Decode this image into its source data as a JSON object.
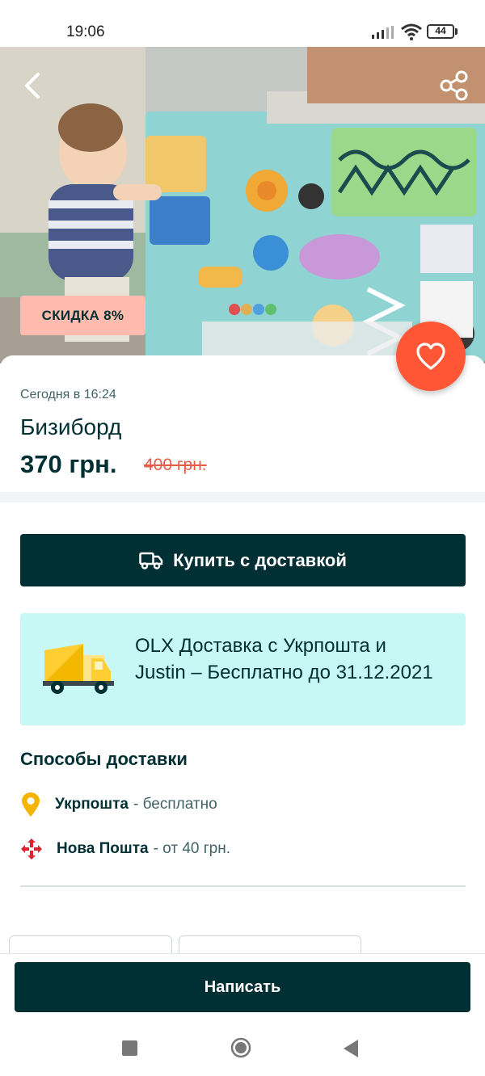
{
  "status_bar": {
    "time": "19:06",
    "battery": "44"
  },
  "listing": {
    "discount_badge": "СКИДКА 8%",
    "posted": "Сегодня в 16:24",
    "title": "Бизиборд",
    "price": "370 грн.",
    "old_price": "400 грн."
  },
  "buy_button": {
    "label": "Купить с доставкой"
  },
  "promo": {
    "text": "OLX Доставка с Укрпошта и Justin – Бесплатно до 31.12.2021"
  },
  "delivery": {
    "heading": "Способы доставки",
    "methods": [
      {
        "name": "Укрпошта",
        "detail": "- бесплатно",
        "icon": "ukrposhta-pin-icon"
      },
      {
        "name": "Нова Пошта",
        "detail": "- от 40 грн.",
        "icon": "novaposhta-icon"
      }
    ]
  },
  "actions": {
    "write_label": "Написать"
  },
  "colors": {
    "brand_dark": "#002f34",
    "accent_orange": "#ff5636",
    "promo_bg": "#c8f8f6",
    "badge_bg": "#ffbcae",
    "old_price": "#e45d47"
  }
}
